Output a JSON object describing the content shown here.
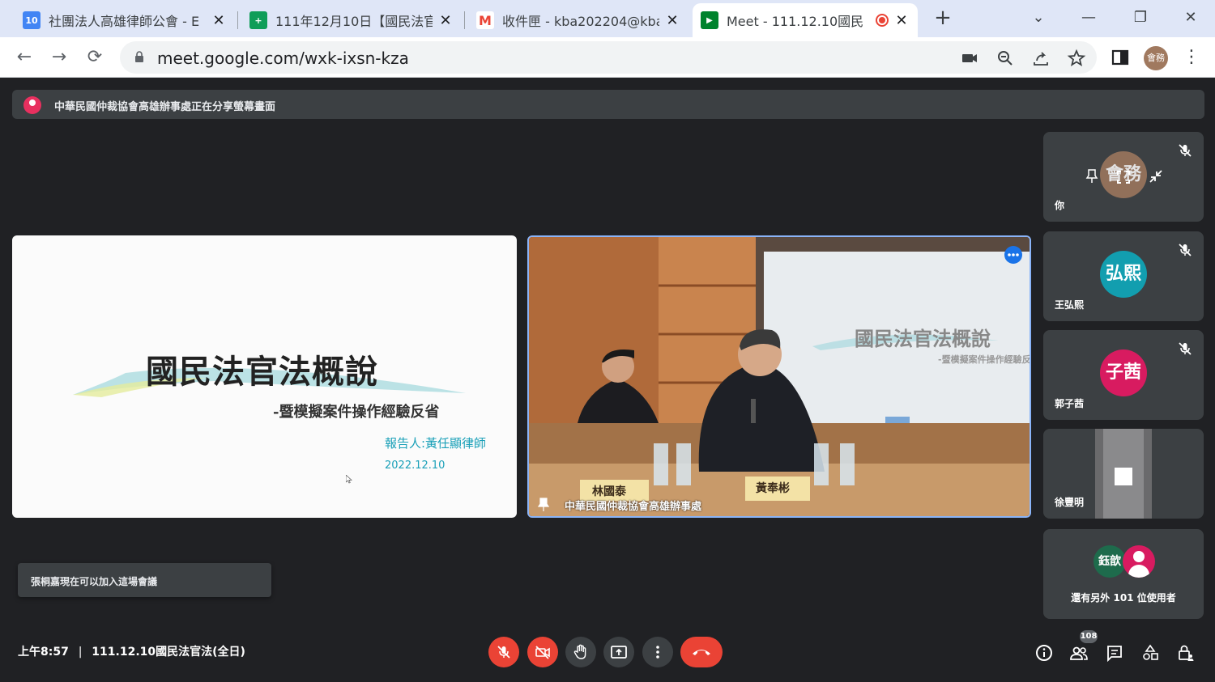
{
  "browser": {
    "tabs": [
      {
        "title": "社團法人高雄律師公會 - E",
        "favicon_text": "10",
        "favicon_color": "#4285f4",
        "active": false
      },
      {
        "title": "111年12月10日【國民法官",
        "favicon_text": "+",
        "favicon_color": "#0f9d58",
        "active": false
      },
      {
        "title": "收件匣 - kba202204@kba",
        "favicon_text": "M",
        "favicon_color": "#ea4335",
        "active": false
      },
      {
        "title": "Meet - 111.12.10國民",
        "favicon_text": "▶",
        "favicon_color": "#00832d",
        "active": true
      }
    ],
    "url": "meet.google.com/wxk-ixsn-kza",
    "profile_label": "會務"
  },
  "meet": {
    "presenting_banner": "中華民國仲裁協會高雄辦事處正在分享螢幕畫面",
    "slide": {
      "title": "國民法官法概說",
      "subtitle": "-暨模擬案件操作經驗反省",
      "reporter": "報告人:黃任顯律師",
      "date": "2022.12.10"
    },
    "video": {
      "name": "中華民國仲裁協會高雄辦事處",
      "nameplate_left": "林國泰",
      "nameplate_right": "黃奉彬",
      "screen_title": "國民法官法概說",
      "screen_subtitle": "-暨模擬案件操作經驗反"
    },
    "participants": [
      {
        "name": "你",
        "avatar_text": "會務",
        "avatar_color": "#a0795f"
      },
      {
        "name": "王弘熙",
        "avatar_text": "弘熙",
        "avatar_color": "#129eaf"
      },
      {
        "name": "郭子茜",
        "avatar_text": "子茜",
        "avatar_color": "#d81b60"
      },
      {
        "name": "徐豐明",
        "avatar_text": "",
        "avatar_color": "#5f6368"
      }
    ],
    "more_tile": {
      "avatar_text": "鈺歆",
      "label": "還有另外 101 位使用者"
    },
    "toast": "張桐嘉現在可以加入這場會議",
    "clock": "上午8:57",
    "meeting_title": "111.12.10國民法官法(全日)",
    "people_count": "108"
  }
}
